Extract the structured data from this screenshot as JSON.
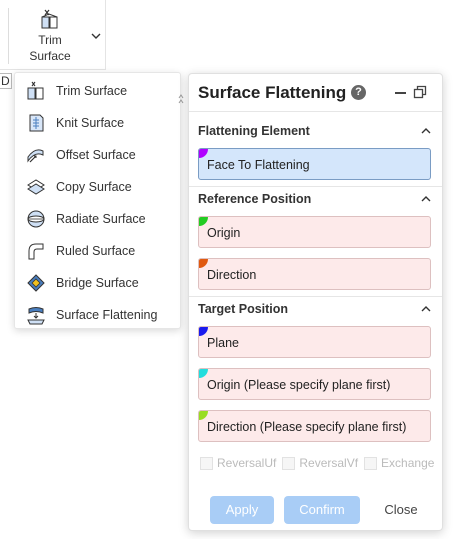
{
  "ribbon": {
    "trim_surface_label": "Trim\nSurface",
    "trim_icon": "trim-surface-icon",
    "dropdown_icon": "chevron-down-icon",
    "edge_fragment": "D"
  },
  "menu": {
    "items": [
      {
        "label": "Trim Surface",
        "icon": "trim-surface-icon"
      },
      {
        "label": "Knit Surface",
        "icon": "knit-surface-icon"
      },
      {
        "label": "Offset Surface",
        "icon": "offset-surface-icon"
      },
      {
        "label": "Copy Surface",
        "icon": "copy-surface-icon"
      },
      {
        "label": "Radiate Surface",
        "icon": "radiate-surface-icon"
      },
      {
        "label": "Ruled Surface",
        "icon": "ruled-surface-icon"
      },
      {
        "label": "Bridge Surface",
        "icon": "bridge-surface-icon"
      },
      {
        "label": "Surface Flattening",
        "icon": "surface-flattening-icon"
      }
    ]
  },
  "panel": {
    "title": "Surface Flattening",
    "help_glyph": "?",
    "sections": {
      "flattening": {
        "heading": "Flattening Element",
        "fields": [
          {
            "label": "Face To Flattening",
            "marker_color": "#b000ff",
            "active": true
          }
        ]
      },
      "reference": {
        "heading": "Reference Position",
        "fields": [
          {
            "label": "Origin",
            "marker_color": "#22cc22"
          },
          {
            "label": "Direction",
            "marker_color": "#e05a10"
          }
        ]
      },
      "target": {
        "heading": "Target Position",
        "fields": [
          {
            "label": "Plane",
            "marker_color": "#1a1aee"
          },
          {
            "label": "Origin (Please specify plane first)",
            "marker_color": "#22dddd"
          },
          {
            "label": "Direction (Please specify plane first)",
            "marker_color": "#99dd22"
          }
        ]
      }
    },
    "checkboxes": [
      {
        "label": "ReversalUf",
        "checked": false,
        "enabled": false
      },
      {
        "label": "ReversalVf",
        "checked": false,
        "enabled": false
      },
      {
        "label": "Exchange",
        "checked": false,
        "enabled": false
      }
    ],
    "buttons": {
      "apply": "Apply",
      "confirm": "Confirm",
      "close": "Close"
    }
  },
  "colors": {
    "accent_button": "#a9cdf6",
    "active_field": "#d4e6fb",
    "inactive_field": "#fdeaea"
  }
}
